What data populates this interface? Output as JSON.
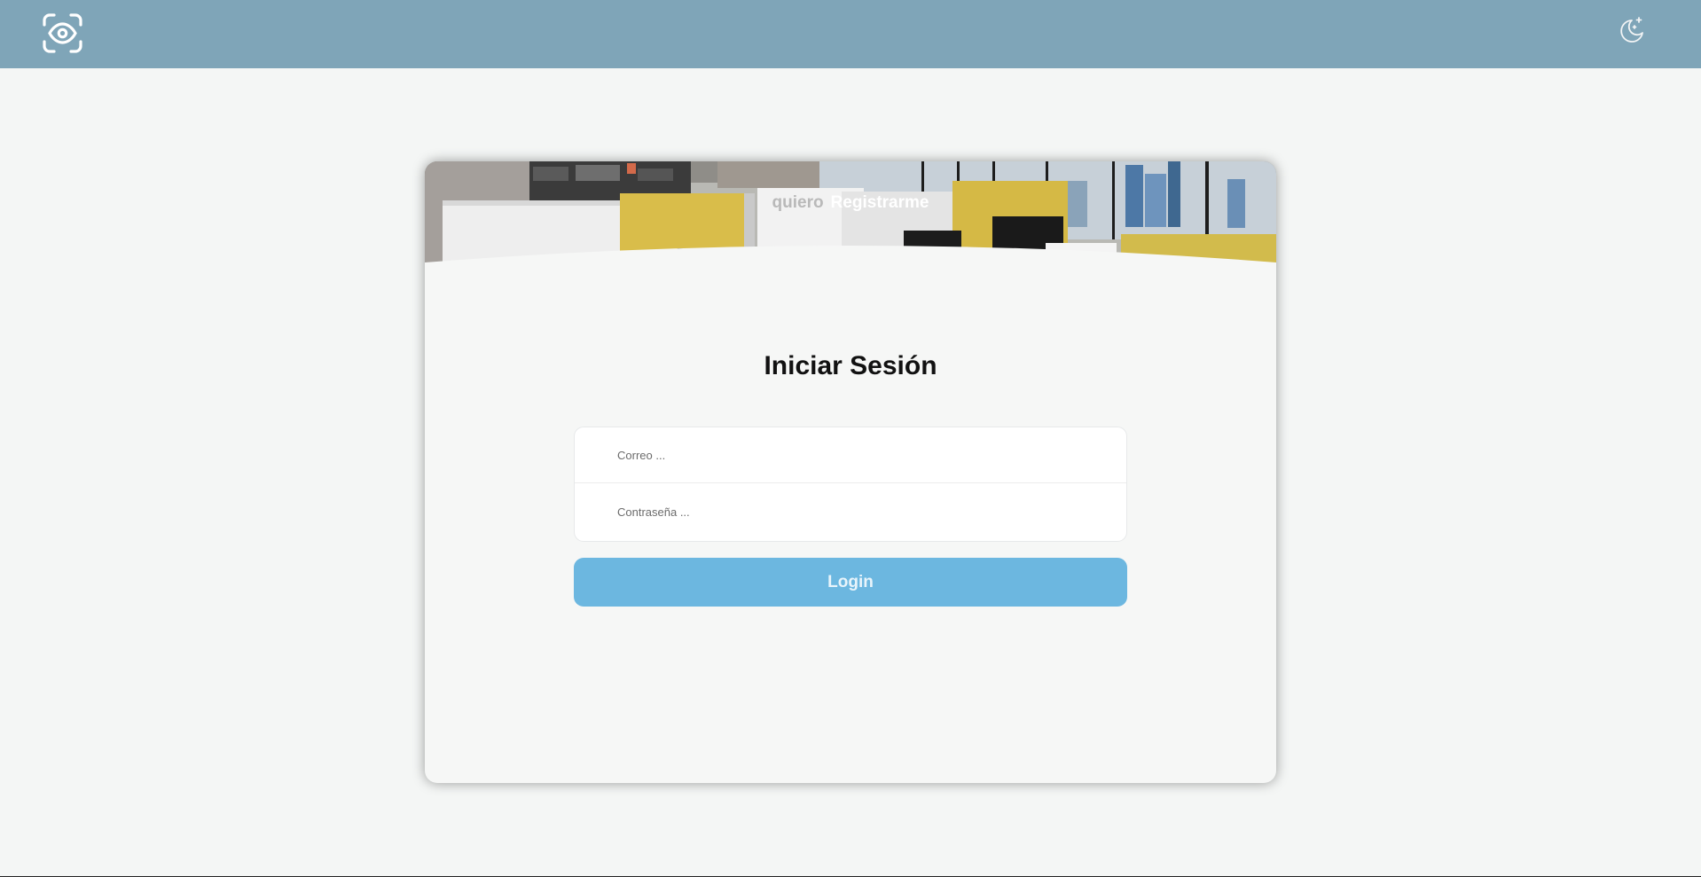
{
  "header": {
    "logo_icon": "eye-scan-icon",
    "theme_icon": "moon-stars-icon",
    "background_color": "#7fa5b8"
  },
  "auth_card": {
    "switch_prefix": "quiero",
    "switch_link": "Registrarme",
    "title": "Iniciar Sesión",
    "email_placeholder": "Correo ...",
    "password_placeholder": "Contraseña ...",
    "login_label": "Login",
    "login_color": "#6cb7e0"
  }
}
